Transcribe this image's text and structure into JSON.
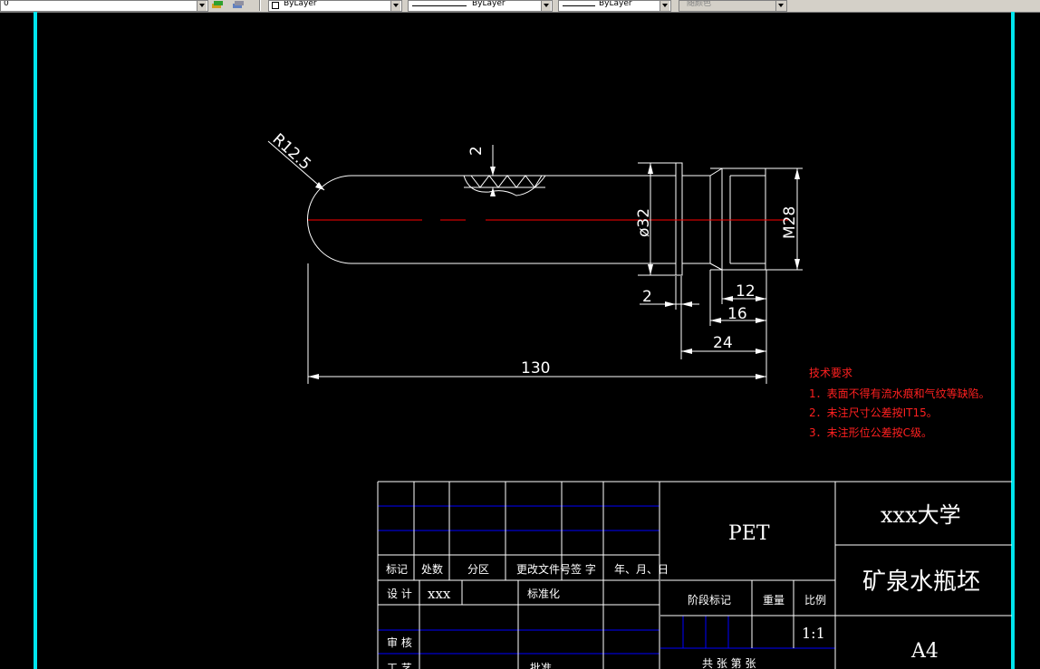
{
  "toolbar": {
    "layer_value": "0",
    "color_value": "ByLayer",
    "linetype_value": "ByLayer",
    "lineweight_value": "ByLayer",
    "plotstyle_value": "随颜色"
  },
  "drawing": {
    "dimensions": {
      "radius": "R12.5",
      "wall": "2",
      "diameter": "ø32",
      "thread": "M28",
      "flange_gap": "2",
      "d12": "12",
      "d16": "16",
      "d24": "24",
      "overall": "130"
    },
    "tech_requirements": {
      "title": "技术要求",
      "items": [
        "1．表面不得有流水痕和气纹等缺陷。",
        "2．未注尺寸公差按IT15。",
        "3．未注形位公差按C级。"
      ]
    }
  },
  "title_block": {
    "headers": [
      "标记",
      "处数",
      "分区",
      "更改文件号",
      "签 字",
      "年、月、日"
    ],
    "design_label": "设 计",
    "design_name": "xxx",
    "standardize_label": "标准化",
    "review_label": "审 核",
    "process_label": "工 艺",
    "approve_label": "批准",
    "material": "PET",
    "stage_label": "阶段标记",
    "weight_label": "重量",
    "scale_label": "比例",
    "scale": "1:1",
    "sheets_label": "共  张  第  张",
    "school": "xxx大学",
    "part_name": "矿泉水瓶坯",
    "paper_size": "A4"
  },
  "colors": {
    "background": "#000000",
    "border": "#00e5ee",
    "lines": "#ffffff",
    "centerline": "#ff0000",
    "grid": "#0000ff",
    "notes": "#ff2020"
  }
}
